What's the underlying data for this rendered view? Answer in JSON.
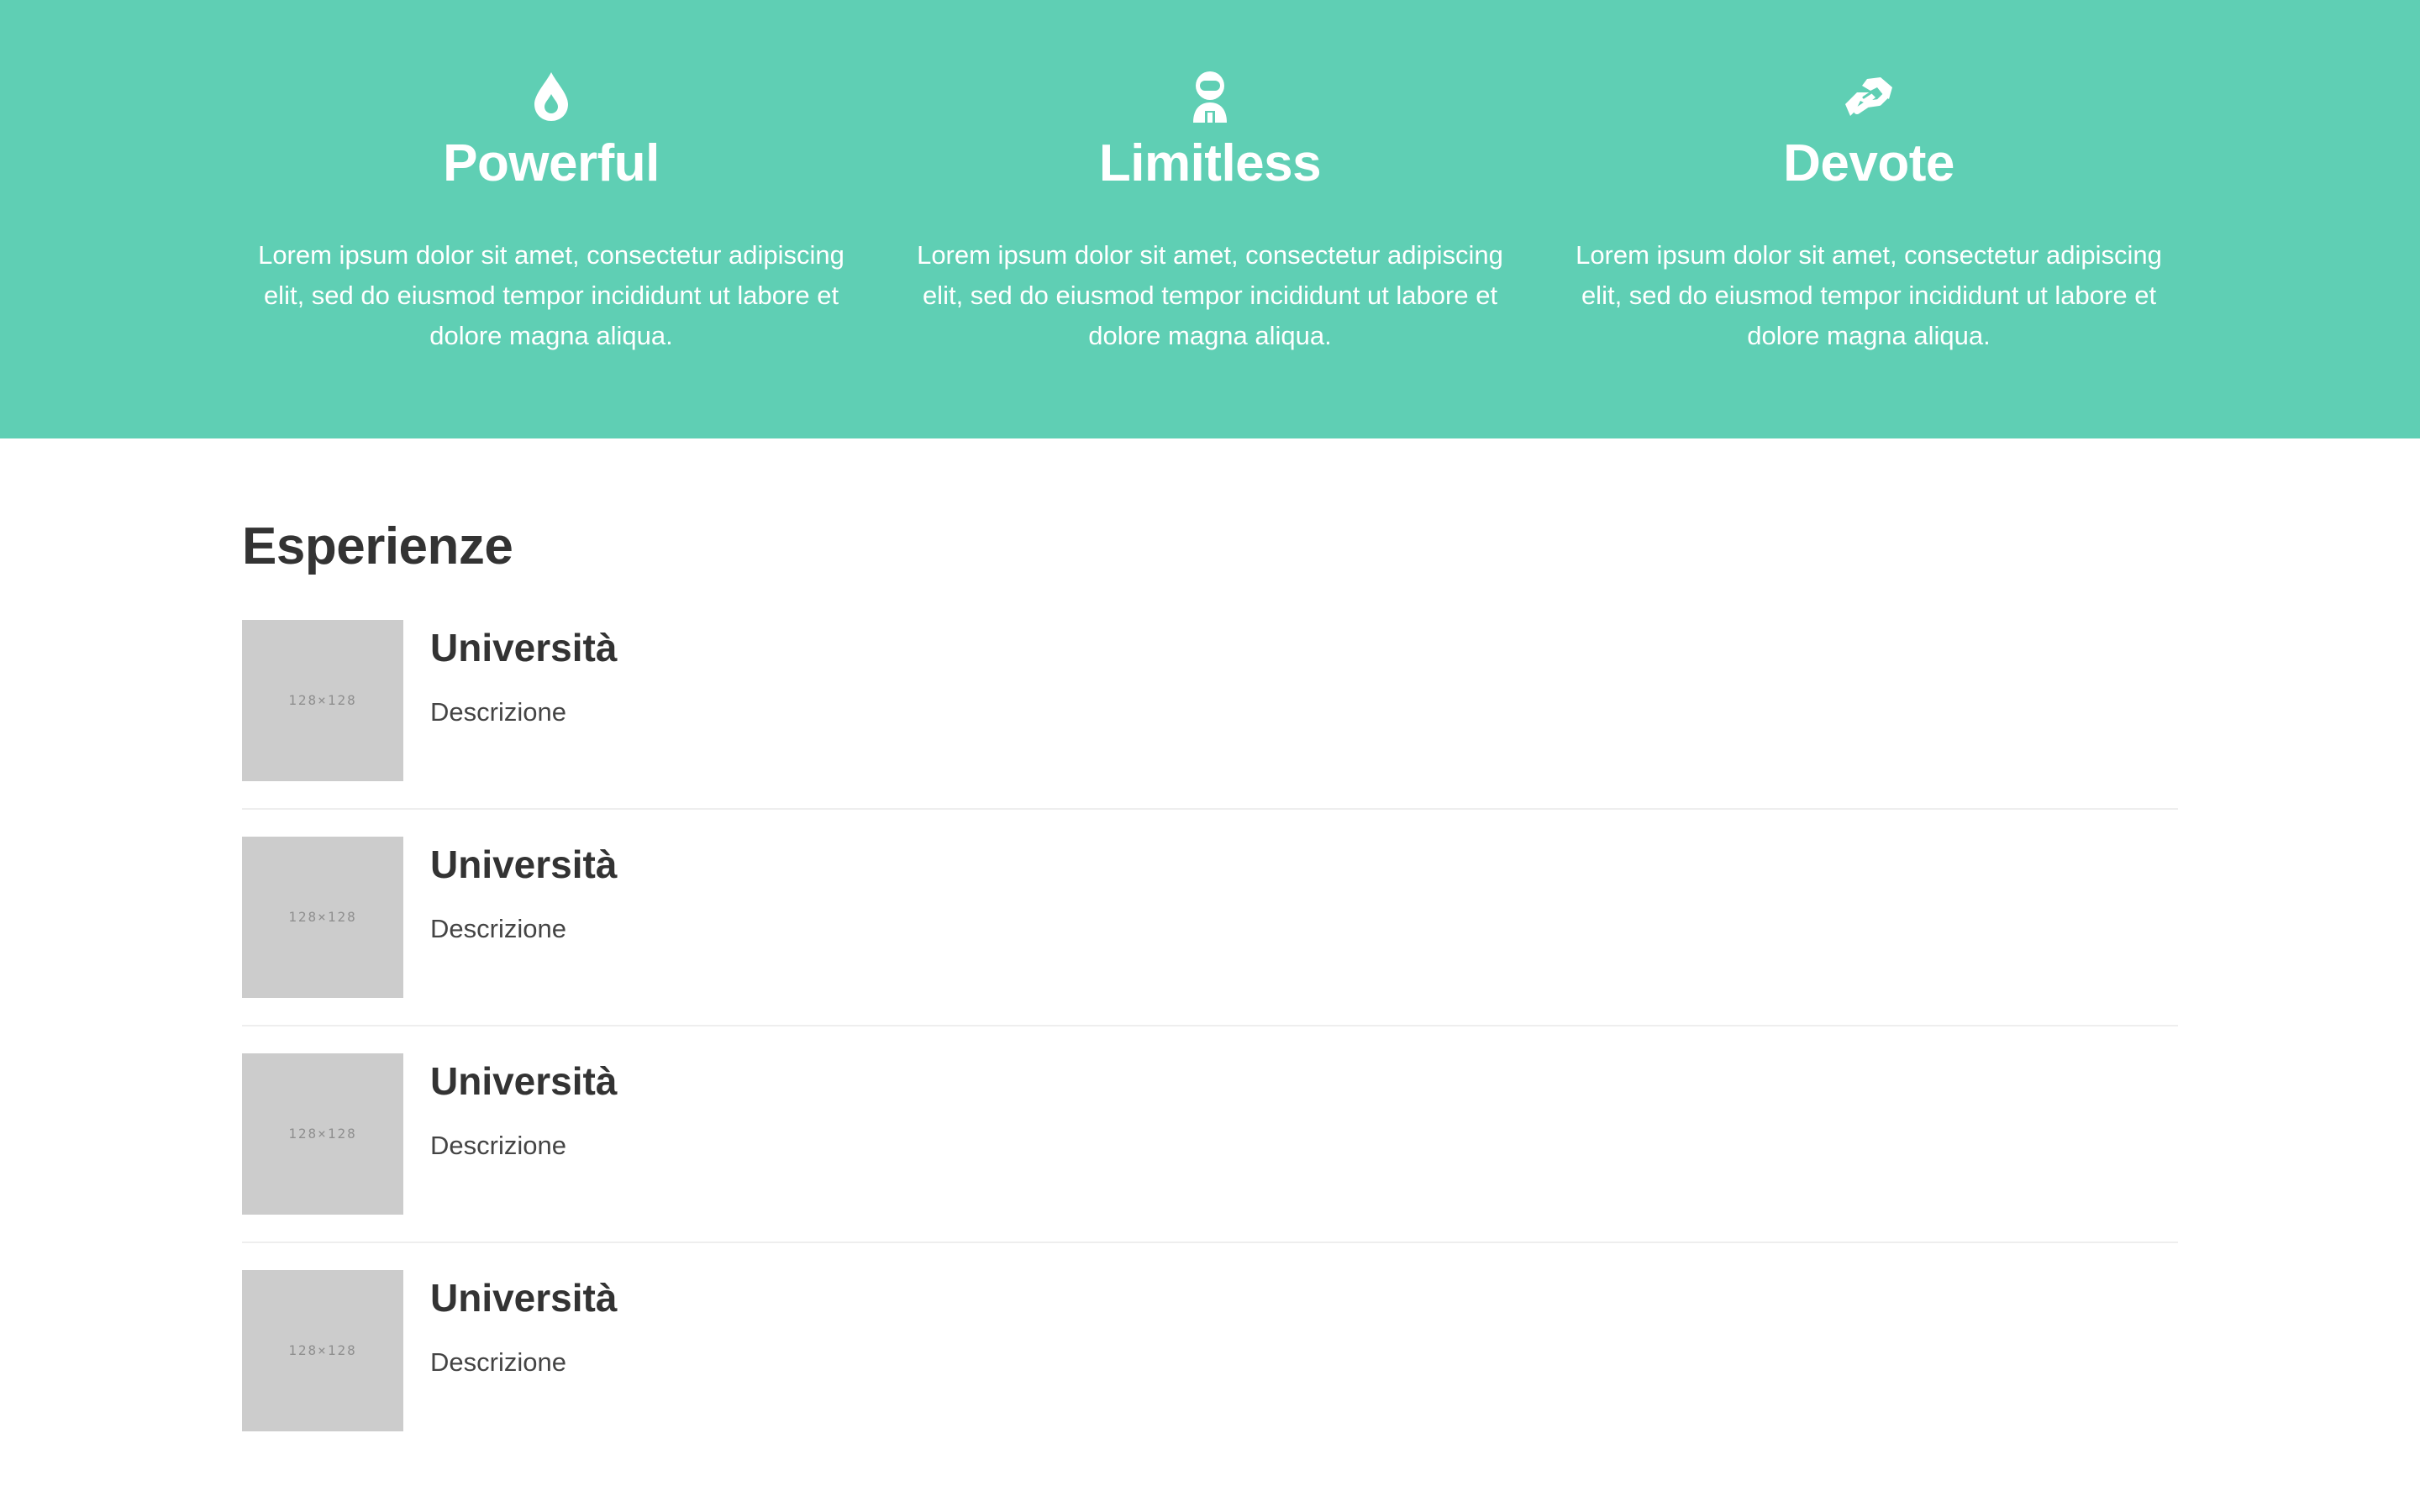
{
  "theme": {
    "accent": "#5fcfb4",
    "placeholder": "#cccccc"
  },
  "features": [
    {
      "icon": "water-drop-icon",
      "title": "Powerful",
      "text": "Lorem ipsum dolor sit amet, consectetur adipiscing elit, sed do eiusmod tempor incididunt ut labore et dolore magna aliqua."
    },
    {
      "icon": "astronaut-icon",
      "title": "Limitless",
      "text": "Lorem ipsum dolor sit amet, consectetur adipiscing elit, sed do eiusmod tempor incididunt ut labore et dolore magna aliqua."
    },
    {
      "icon": "handshake-icon",
      "title": "Devote",
      "text": "Lorem ipsum dolor sit amet, consectetur adipiscing elit, sed do eiusmod tempor incididunt ut labore et dolore magna aliqua."
    }
  ],
  "experiences": {
    "title": "Esperienze",
    "items": [
      {
        "thumb_label": "128×128",
        "title": "Università",
        "description": "Descrizione"
      },
      {
        "thumb_label": "128×128",
        "title": "Università",
        "description": "Descrizione"
      },
      {
        "thumb_label": "128×128",
        "title": "Università",
        "description": "Descrizione"
      },
      {
        "thumb_label": "128×128",
        "title": "Università",
        "description": "Descrizione"
      }
    ]
  }
}
